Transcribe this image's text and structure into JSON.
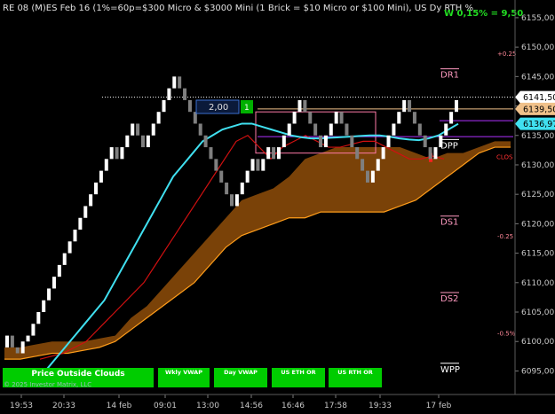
{
  "header": {
    "title": "RE 08 (M)ES Feb 16 (1%=60p=$300 Micro & $3000 Mini  (1 Brick = $10 Micro or $100 Mini), US Dy RTH %",
    "change": "W 0,15% = 9,50"
  },
  "chart_data": {
    "type": "candlestick-renko",
    "ylim": [
      6091,
      6158
    ],
    "y_ticks": [
      6095,
      6100,
      6105,
      6110,
      6115,
      6120,
      6125,
      6130,
      6135,
      6140,
      6145,
      6150,
      6155
    ],
    "x_ticks": [
      "19:53",
      "20:33",
      "14 feb",
      "09:01",
      "13:00",
      "14:56",
      "16:46",
      "17:58",
      "19:33",
      "17 feb"
    ],
    "price_tags": [
      {
        "label": "6141,50",
        "value": 6141.5,
        "color": "#ffffff"
      },
      {
        "label": "6139,50",
        "value": 6139.5,
        "color": "#f0c18a"
      },
      {
        "label": "6136,97",
        "value": 6136.97,
        "color": "#40e0f0"
      }
    ],
    "levels": [
      {
        "name": "DR1",
        "value": 6144.5,
        "color": "#ff9ac0"
      },
      {
        "name": "DPP",
        "value": 6132.5,
        "color": "#ffffff"
      },
      {
        "name": "DS1",
        "value": 6119.5,
        "color": "#ff9ac0"
      },
      {
        "name": "DS2",
        "value": 6106.5,
        "color": "#ff9ac0"
      },
      {
        "name": "WPP",
        "value": 6094.5,
        "color": "#ffffff"
      }
    ],
    "pct_labels": [
      {
        "text": "+0.25",
        "value": 6148.5
      },
      {
        "text": "-0.25",
        "value": 6117.5
      },
      {
        "text": "-0.5%",
        "value": 6101
      }
    ],
    "clos_label": "CLOS",
    "box_value": "2,00",
    "box_count": "1",
    "renko_closes": [
      6101,
      6099,
      6098,
      6100,
      6101,
      6103,
      6105,
      6107,
      6109,
      6111,
      6113,
      6115,
      6117,
      6119,
      6121,
      6123,
      6125,
      6127,
      6129,
      6131,
      6133,
      6131,
      6133,
      6135,
      6137,
      6135,
      6133,
      6135,
      6137,
      6139,
      6141,
      6143,
      6145,
      6143,
      6141,
      6139,
      6137,
      6135,
      6133,
      6131,
      6129,
      6127,
      6125,
      6123,
      6125,
      6127,
      6129,
      6131,
      6129,
      6131,
      6133,
      6131,
      6133,
      6135,
      6137,
      6139,
      6141,
      6139,
      6137,
      6135,
      6133,
      6135,
      6137,
      6139,
      6137,
      6135,
      6133,
      6131,
      6129,
      6127,
      6129,
      6131,
      6133,
      6135,
      6137,
      6139,
      6141,
      6139,
      6137,
      6135,
      6133,
      6131,
      6133,
      6135,
      6137,
      6139,
      6141
    ],
    "renko_colors": [
      "#ffffff",
      "#7f7f7f"
    ],
    "cyan_line": [
      6093,
      6095,
      6097,
      6099,
      6101,
      6103,
      6105,
      6107,
      6110,
      6113,
      6116,
      6119,
      6122,
      6125,
      6128,
      6130,
      6132,
      6134,
      6135,
      6136,
      6136.5,
      6137,
      6137,
      6136.5,
      6136,
      6135.5,
      6135,
      6134.7,
      6134.5,
      6134.5,
      6134.6,
      6134.7,
      6134.8,
      6134.9,
      6135,
      6135,
      6134.8,
      6134.5,
      6134.3,
      6134.2,
      6134.5,
      6135,
      6136,
      6136.97
    ],
    "red_line": [
      6097,
      6097.5,
      6098,
      6099,
      6100,
      6102,
      6104,
      6106,
      6108,
      6110,
      6113,
      6116,
      6119,
      6122,
      6125,
      6128,
      6131,
      6134,
      6135,
      6133,
      6131,
      6133,
      6134,
      6135,
      6134,
      6133,
      6133,
      6133.5,
      6134,
      6134,
      6133,
      6132,
      6131,
      6131,
      6131.5,
      6131
    ],
    "cloud_top": [
      6099,
      6099,
      6099.5,
      6100,
      6100,
      6100,
      6100.5,
      6101,
      6104,
      6106,
      6109,
      6112,
      6115,
      6118,
      6121,
      6124,
      6125,
      6126,
      6128,
      6131,
      6132,
      6133,
      6133,
      6133,
      6133,
      6133,
      6132,
      6131,
      6132,
      6132,
      6133,
      6134,
      6134
    ],
    "cloud_bottom": [
      6097,
      6097,
      6097.5,
      6098,
      6098,
      6098.5,
      6099,
      6100,
      6102,
      6104,
      6106,
      6108,
      6110,
      6113,
      6116,
      6118,
      6119,
      6120,
      6121,
      6121,
      6122,
      6122,
      6122,
      6122,
      6122,
      6123,
      6124,
      6126,
      6128,
      6130,
      6132,
      6133,
      6133
    ]
  },
  "status_buttons": [
    {
      "label": "Price Outside Clouds"
    },
    {
      "label": "Wkly VWAP"
    },
    {
      "label": "Day VWAP"
    },
    {
      "label": "US ETH OR"
    },
    {
      "label": "US RTH OR"
    }
  ],
  "copyright": "© 2025 Investor Matrix, LLC",
  "colors": {
    "background": "#000000",
    "button_green": "#00cc00",
    "cloud": "#7a4208",
    "cloud_edge": "#ff9d1a",
    "cyan": "#40e0f0",
    "red": "#d01010",
    "axis_text": "#c8c8c8"
  }
}
